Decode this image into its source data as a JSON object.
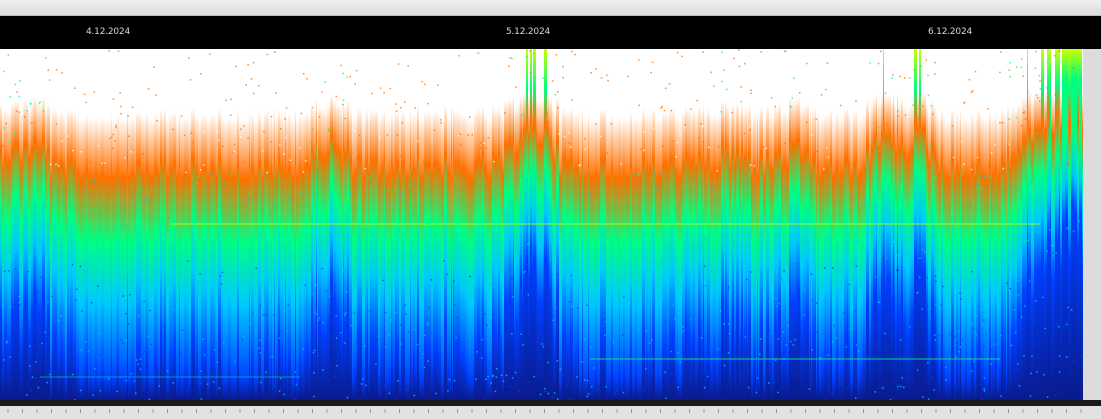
{
  "chart_data": {
    "type": "heatmap",
    "title": "",
    "xlabel": "",
    "ylabel": "",
    "date_labels": [
      "4.12.2024",
      "5.12.2024",
      "6.12.2024"
    ],
    "colormap": [
      "#0a1a8c",
      "#0040ff",
      "#00c8ff",
      "#00ff80",
      "#c8ff00",
      "#ff7000",
      "#ffffff"
    ],
    "grid": false,
    "legend": "none"
  }
}
